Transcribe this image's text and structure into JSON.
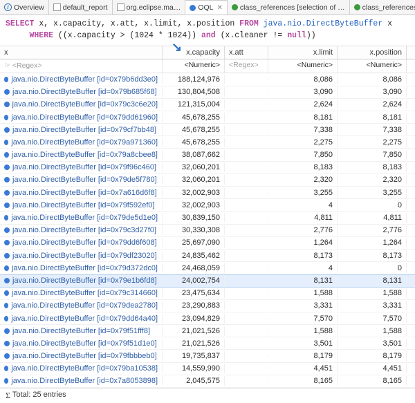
{
  "tabs": [
    {
      "label": "Overview",
      "kind": "info"
    },
    {
      "label": "default_report",
      "kind": "report"
    },
    {
      "label": "org.eclipse.ma…",
      "kind": "report"
    },
    {
      "label": "OQL",
      "kind": "oql",
      "active": true
    },
    {
      "label": "class_references [selection of …",
      "kind": "green"
    },
    {
      "label": "class_references [sele",
      "kind": "green"
    }
  ],
  "query": {
    "line1a": "SELECT",
    "line1b": " x, x.capacity, x.att, x.limit, x.position ",
    "line1c": "FROM",
    "line1d": " java.nio.DirectByteBuffer",
    "line1e": " x",
    "line2a": "     WHERE",
    "line2b": " ((x.capacity > (1024 * 1024)) ",
    "line2c": "and",
    "line2d": " (x.cleaner != ",
    "line2e": "null",
    "line2f": "))"
  },
  "columns": {
    "x": "x",
    "capacity": "x.capacity",
    "att": "x.att",
    "limit": "x.limit",
    "position": "x.position"
  },
  "filters": {
    "regex": "<Regex>",
    "numeric": "<Numeric>"
  },
  "rows": [
    {
      "x": "java.nio.DirectByteBuffer [id=0x79b6dd3e0]",
      "capacity": "188,124,976",
      "att": "",
      "limit": "8,086",
      "position": "8,086"
    },
    {
      "x": "java.nio.DirectByteBuffer [id=0x79b685f68]",
      "capacity": "130,804,508",
      "att": "",
      "limit": "3,090",
      "position": "3,090"
    },
    {
      "x": "java.nio.DirectByteBuffer [id=0x79c3c6e20]",
      "capacity": "121,315,004",
      "att": "",
      "limit": "2,624",
      "position": "2,624"
    },
    {
      "x": "java.nio.DirectByteBuffer [id=0x79dd61960]",
      "capacity": "45,678,255",
      "att": "",
      "limit": "8,181",
      "position": "8,181"
    },
    {
      "x": "java.nio.DirectByteBuffer [id=0x79cf7bb48]",
      "capacity": "45,678,255",
      "att": "",
      "limit": "7,338",
      "position": "7,338"
    },
    {
      "x": "java.nio.DirectByteBuffer [id=0x79a971360]",
      "capacity": "45,678,255",
      "att": "",
      "limit": "2,275",
      "position": "2,275"
    },
    {
      "x": "java.nio.DirectByteBuffer [id=0x79a8cbee8]",
      "capacity": "38,087,662",
      "att": "",
      "limit": "7,850",
      "position": "7,850"
    },
    {
      "x": "java.nio.DirectByteBuffer [id=0x79f96c460]",
      "capacity": "32,060,201",
      "att": "",
      "limit": "8,183",
      "position": "8,183"
    },
    {
      "x": "java.nio.DirectByteBuffer [id=0x79de5f780]",
      "capacity": "32,060,201",
      "att": "",
      "limit": "2,320",
      "position": "2,320"
    },
    {
      "x": "java.nio.DirectByteBuffer [id=0x7a616d6f8]",
      "capacity": "32,002,903",
      "att": "",
      "limit": "3,255",
      "position": "3,255"
    },
    {
      "x": "java.nio.DirectByteBuffer [id=0x79f592ef0]",
      "capacity": "32,002,903",
      "att": "",
      "limit": "4",
      "position": "0"
    },
    {
      "x": "java.nio.DirectByteBuffer [id=0x79de5d1e0]",
      "capacity": "30,839,150",
      "att": "",
      "limit": "4,811",
      "position": "4,811"
    },
    {
      "x": "java.nio.DirectByteBuffer [id=0x79c3d27f0]",
      "capacity": "30,330,308",
      "att": "",
      "limit": "2,776",
      "position": "2,776"
    },
    {
      "x": "java.nio.DirectByteBuffer [id=0x79dd6f608]",
      "capacity": "25,697,090",
      "att": "",
      "limit": "1,264",
      "position": "1,264"
    },
    {
      "x": "java.nio.DirectByteBuffer [id=0x79df23020]",
      "capacity": "24,835,462",
      "att": "",
      "limit": "8,173",
      "position": "8,173"
    },
    {
      "x": "java.nio.DirectByteBuffer [id=0x79d372dc0]",
      "capacity": "24,468,059",
      "att": "",
      "limit": "4",
      "position": "0"
    },
    {
      "x": "java.nio.DirectByteBuffer [id=0x79e1b6fd8]",
      "capacity": "24,002,754",
      "att": "",
      "limit": "8,131",
      "position": "8,131",
      "selected": true
    },
    {
      "x": "java.nio.DirectByteBuffer [id=0x79c314660]",
      "capacity": "23,475,634",
      "att": "",
      "limit": "1,588",
      "position": "1,588"
    },
    {
      "x": "java.nio.DirectByteBuffer [id=0x79dea2780]",
      "capacity": "23,290,883",
      "att": "",
      "limit": "3,331",
      "position": "3,331"
    },
    {
      "x": "java.nio.DirectByteBuffer [id=0x79dd64a40]",
      "capacity": "23,094,829",
      "att": "",
      "limit": "7,570",
      "position": "7,570"
    },
    {
      "x": "java.nio.DirectByteBuffer [id=0x79f51fff8]",
      "capacity": "21,021,526",
      "att": "",
      "limit": "1,588",
      "position": "1,588"
    },
    {
      "x": "java.nio.DirectByteBuffer [id=0x79f51d1e0]",
      "capacity": "21,021,526",
      "att": "",
      "limit": "3,501",
      "position": "3,501"
    },
    {
      "x": "java.nio.DirectByteBuffer [id=0x79fbbbeb0]",
      "capacity": "19,735,837",
      "att": "",
      "limit": "8,179",
      "position": "8,179"
    },
    {
      "x": "java.nio.DirectByteBuffer [id=0x79ba10538]",
      "capacity": "14,559,990",
      "att": "",
      "limit": "4,451",
      "position": "4,451"
    },
    {
      "x": "java.nio.DirectByteBuffer [id=0x7a8053898]",
      "capacity": "2,045,575",
      "att": "",
      "limit": "8,165",
      "position": "8,165"
    }
  ],
  "footer": {
    "total": "Total: 25 entries"
  }
}
